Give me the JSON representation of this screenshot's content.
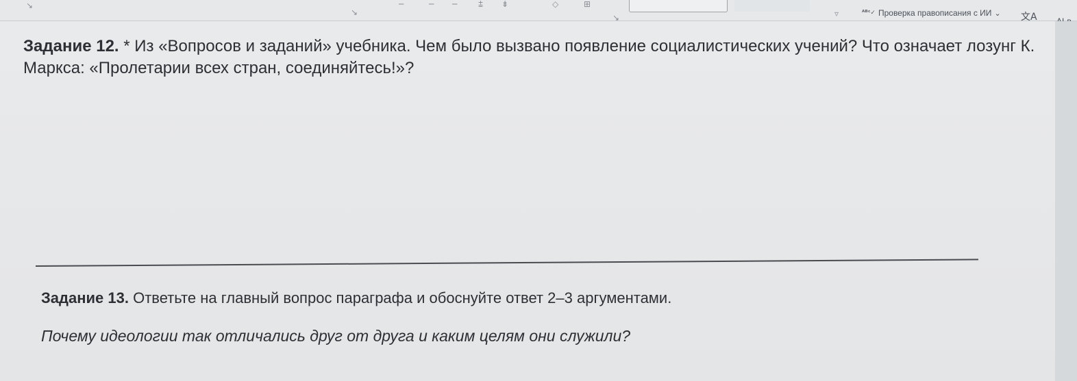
{
  "ribbon": {
    "spell_check_label": "Проверка правописания с ИИ",
    "spell_check_icon": "spell-check-icon",
    "translate_icon": "translate-icon",
    "ai_label": "AI-в"
  },
  "document": {
    "task12": {
      "number": "Задание 12.",
      "text": "* Из «Вопросов и заданий» учебника. Чем было вызвано появление социалистических учений? Что означает лозунг К. Маркса: «Пролетарии всех стран, соединяйтесь!»?"
    },
    "task13": {
      "number": "Задание 13.",
      "text": "Ответьте на главный вопрос параграфа и обоснуйте ответ 2–3 аргументами."
    },
    "question": "Почему идеологии так отличались друг от друга и каким целям они служили?"
  }
}
